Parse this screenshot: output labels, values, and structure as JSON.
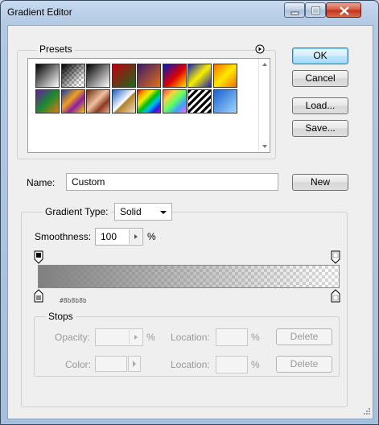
{
  "window": {
    "title": "Gradient Editor"
  },
  "presets": {
    "label": "Presets",
    "menu_icon": "circle-arrow-icon",
    "swatches": [
      {
        "name": "Foreground to Background",
        "css": "linear-gradient(135deg,#000 0%,#fff 100%)"
      },
      {
        "name": "Foreground to Transparent",
        "css": "checker"
      },
      {
        "name": "Black, White",
        "css": "linear-gradient(135deg,#000 0%,#fff 100%)"
      },
      {
        "name": "Red, Green",
        "css": "linear-gradient(135deg,#c00010 0%,#1a6b1a 100%)"
      },
      {
        "name": "Violet, Orange",
        "css": "linear-gradient(135deg,#3a1a6a 0%,#e0701a 100%)"
      },
      {
        "name": "Blue, Red, Yellow",
        "css": "linear-gradient(135deg,#0018c0 0%,#e00000 55%,#ffe000 100%)"
      },
      {
        "name": "Blue, Yellow, Blue",
        "css": "linear-gradient(135deg,#1a20b0 0%,#f8f000 50%,#1a20b0 100%)"
      },
      {
        "name": "Orange, Yellow, Orange",
        "css": "linear-gradient(135deg,#f07000 0%,#ffe800 50%,#f07000 100%)"
      },
      {
        "name": "Violet, Green, Orange",
        "css": "linear-gradient(135deg,#6a1aa0 0%,#1a8a30 50%,#e07a10 100%)"
      },
      {
        "name": "Yellow, Violet, Orange, Blue",
        "css": "linear-gradient(135deg,#1a3aa0 0%,#f0a020 40%,#8a20a0 65%,#f8d000 100%)"
      },
      {
        "name": "Copper",
        "css": "linear-gradient(135deg,#6a2a10 0%,#f0c0a0 45%,#8a3a20 70%,#e8b090 100%)"
      },
      {
        "name": "Chrome",
        "css": "linear-gradient(135deg,#1a60c0 0%,#ffffff 50%,#b0802a 55%,#f0e0c0 100%)"
      },
      {
        "name": "Spectrum",
        "css": "linear-gradient(135deg,#e00000,#f0a000,#f0f000,#00c000,#00c0f0,#2020e0,#c000c0)"
      },
      {
        "name": "Transparent Rainbow",
        "css": "linear-gradient(135deg,#ff4040,#ffd040,#60ff60,#40a0ff,#ff60ff)"
      },
      {
        "name": "Transparent Stripes",
        "css": "repeating-linear-gradient(135deg,#000 0 3px,#fff 3px 6px)"
      },
      {
        "name": "Blue",
        "css": "linear-gradient(135deg,#1a60d0 0%,#a0d8ff 100%)"
      }
    ]
  },
  "buttons": {
    "ok": "OK",
    "cancel": "Cancel",
    "load": "Load...",
    "save": "Save...",
    "new": "New"
  },
  "name_field": {
    "label": "Name:",
    "value": "Custom"
  },
  "gradient_type": {
    "label": "Gradient Type:",
    "selected": "Solid",
    "smoothness_label": "Smoothness:",
    "smoothness_value": "100",
    "percent": "%"
  },
  "editor": {
    "color_readout": "#8b8b8b"
  },
  "stops": {
    "label": "Stops",
    "opacity_label": "Opacity:",
    "color_label": "Color:",
    "location_label": "Location:",
    "percent": "%",
    "delete_label": "Delete"
  }
}
